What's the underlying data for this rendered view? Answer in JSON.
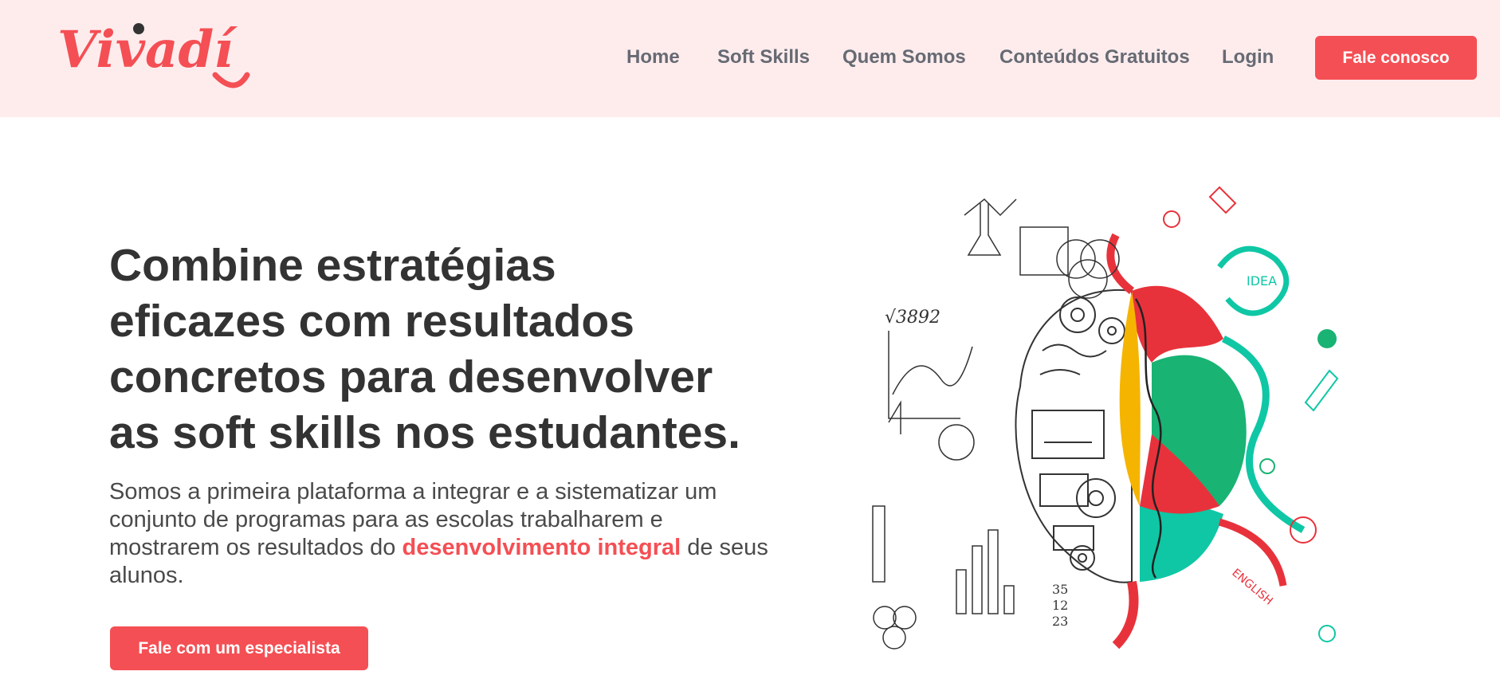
{
  "brand": {
    "logo_text": "Vivadí",
    "accent_color": "#f44f54",
    "header_bg": "#feeced"
  },
  "nav": {
    "items": [
      {
        "label": "Home"
      },
      {
        "label": "Soft Skills"
      },
      {
        "label": "Quem Somos"
      },
      {
        "label": "Conteúdos Gratuitos"
      },
      {
        "label": "Login"
      }
    ],
    "cta_label": "Fale conosco"
  },
  "hero": {
    "title_lines": [
      "Combine estratégias",
      "eficazes com resultados",
      "concretos para desenvolver",
      "as soft skills nos estudantes."
    ],
    "description_before": "Somos a primeira plataforma a integrar e a sistematizar um conjunto de programas para as escolas trabalharem e mostrarem os resultados do ",
    "description_highlight": "desenvolvimento integral",
    "description_after": " de seus alunos.",
    "cta_label": "Fale com um especialista"
  },
  "illustration": {
    "labels": {
      "sqrt": "√3892",
      "idea": "IDEA",
      "english": "ENGLISH",
      "n35": "35",
      "n12": "12",
      "n23": "23"
    }
  }
}
